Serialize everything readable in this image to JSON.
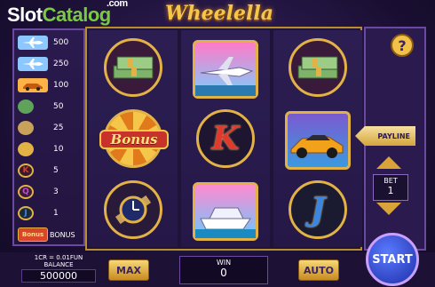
{
  "watermark": {
    "slot": "Slot",
    "catalog": "Catalog",
    "com": ".com"
  },
  "game": {
    "title": "Wheelella"
  },
  "paytable": [
    {
      "icon": "jet-icon",
      "color": "#8cc7ff",
      "mult": "500"
    },
    {
      "icon": "jet-icon",
      "color": "#8cc7ff",
      "mult": "250"
    },
    {
      "icon": "car-icon",
      "color": "#ffb347",
      "mult": "100"
    },
    {
      "icon": "money-icon",
      "color": "#5fa35a",
      "mult": "50"
    },
    {
      "icon": "watch-icon",
      "color": "#c8a25a",
      "mult": "25"
    },
    {
      "icon": "coin-icon",
      "color": "#e2b247",
      "mult": "10"
    },
    {
      "icon": "k-icon",
      "color": "#e03a2e",
      "mult": "5"
    },
    {
      "icon": "q-icon",
      "color": "#c04fd0",
      "mult": "3"
    },
    {
      "icon": "j-icon",
      "color": "#3a86e0",
      "mult": "1"
    },
    {
      "icon": "bonus-icon",
      "color": "#d8462b",
      "label": "Bonus",
      "mult": "BONUS"
    }
  ],
  "reels": [
    [
      {
        "name": "money-symbol",
        "type": "money"
      },
      {
        "name": "bonus-symbol",
        "type": "bonus",
        "text": "Bonus"
      },
      {
        "name": "watch-symbol",
        "type": "watch"
      }
    ],
    [
      {
        "name": "jet-symbol",
        "type": "jet"
      },
      {
        "name": "k-symbol",
        "type": "letter",
        "text": "K",
        "color": "#e03a2e"
      },
      {
        "name": "yacht-symbol",
        "type": "yacht"
      }
    ],
    [
      {
        "name": "money-symbol",
        "type": "money"
      },
      {
        "name": "car-symbol",
        "type": "car"
      },
      {
        "name": "j-symbol",
        "type": "letter",
        "text": "J",
        "color": "#3a86e0"
      }
    ]
  ],
  "controls": {
    "help": "?",
    "payline": "PAYLINE",
    "bet_label": "BET",
    "bet_value": "1",
    "rate": "1CR = 0.01FUN",
    "balance_label": "BALANCE",
    "balance_value": "500000",
    "max": "MAX",
    "win_label": "WIN",
    "win_value": "0",
    "auto": "AUTO",
    "start": "START"
  }
}
